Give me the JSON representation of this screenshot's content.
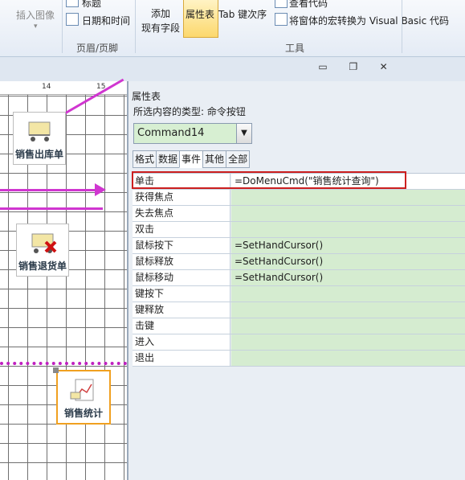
{
  "ribbon": {
    "insert_image_label": "插入图像",
    "title_label": "标题",
    "datetime_label": "日期和时间",
    "header_footer_group": "页眉/页脚",
    "add_existing_fields_line1": "添加",
    "add_existing_fields_line2": "现有字段",
    "property_sheet_label": "属性表",
    "tab_order_label": "Tab 键次序",
    "view_code_label": "查看代码",
    "convert_macros_label": "将窗体的宏转换为 Visual Basic 代码",
    "tools_group": "工具"
  },
  "window_controls": {
    "minimize": "▭",
    "restore": "❐",
    "close": "✕"
  },
  "ruler": {
    "mark14": "14",
    "mark15": "15"
  },
  "form": {
    "buttons": [
      {
        "label": "销售出库单"
      },
      {
        "label": "销售退货单"
      },
      {
        "label": "销售统计"
      }
    ]
  },
  "property_sheet": {
    "title": "属性表",
    "selection_type": "所选内容的类型: 命令按钮",
    "selected_control": "Command14",
    "tabs": [
      "格式",
      "数据",
      "事件",
      "其他",
      "全部"
    ],
    "active_tab": "事件",
    "rows": [
      {
        "name": "单击",
        "value": "=DoMenuCmd(\"销售统计查询\")"
      },
      {
        "name": "获得焦点",
        "value": ""
      },
      {
        "name": "失去焦点",
        "value": ""
      },
      {
        "name": "双击",
        "value": ""
      },
      {
        "name": "鼠标按下",
        "value": "=SetHandCursor()"
      },
      {
        "name": "鼠标释放",
        "value": "=SetHandCursor()"
      },
      {
        "name": "鼠标移动",
        "value": "=SetHandCursor()"
      },
      {
        "name": "键按下",
        "value": ""
      },
      {
        "name": "键释放",
        "value": ""
      },
      {
        "name": "击键",
        "value": ""
      },
      {
        "name": "进入",
        "value": ""
      },
      {
        "name": "退出",
        "value": ""
      }
    ]
  },
  "colors": {
    "grid_value_bg": "#d5ecd0",
    "highlight_box": "#cc1f1f",
    "annotation_arrow": "#d036d0",
    "selected_ribbon_button": "#fcd86d"
  }
}
